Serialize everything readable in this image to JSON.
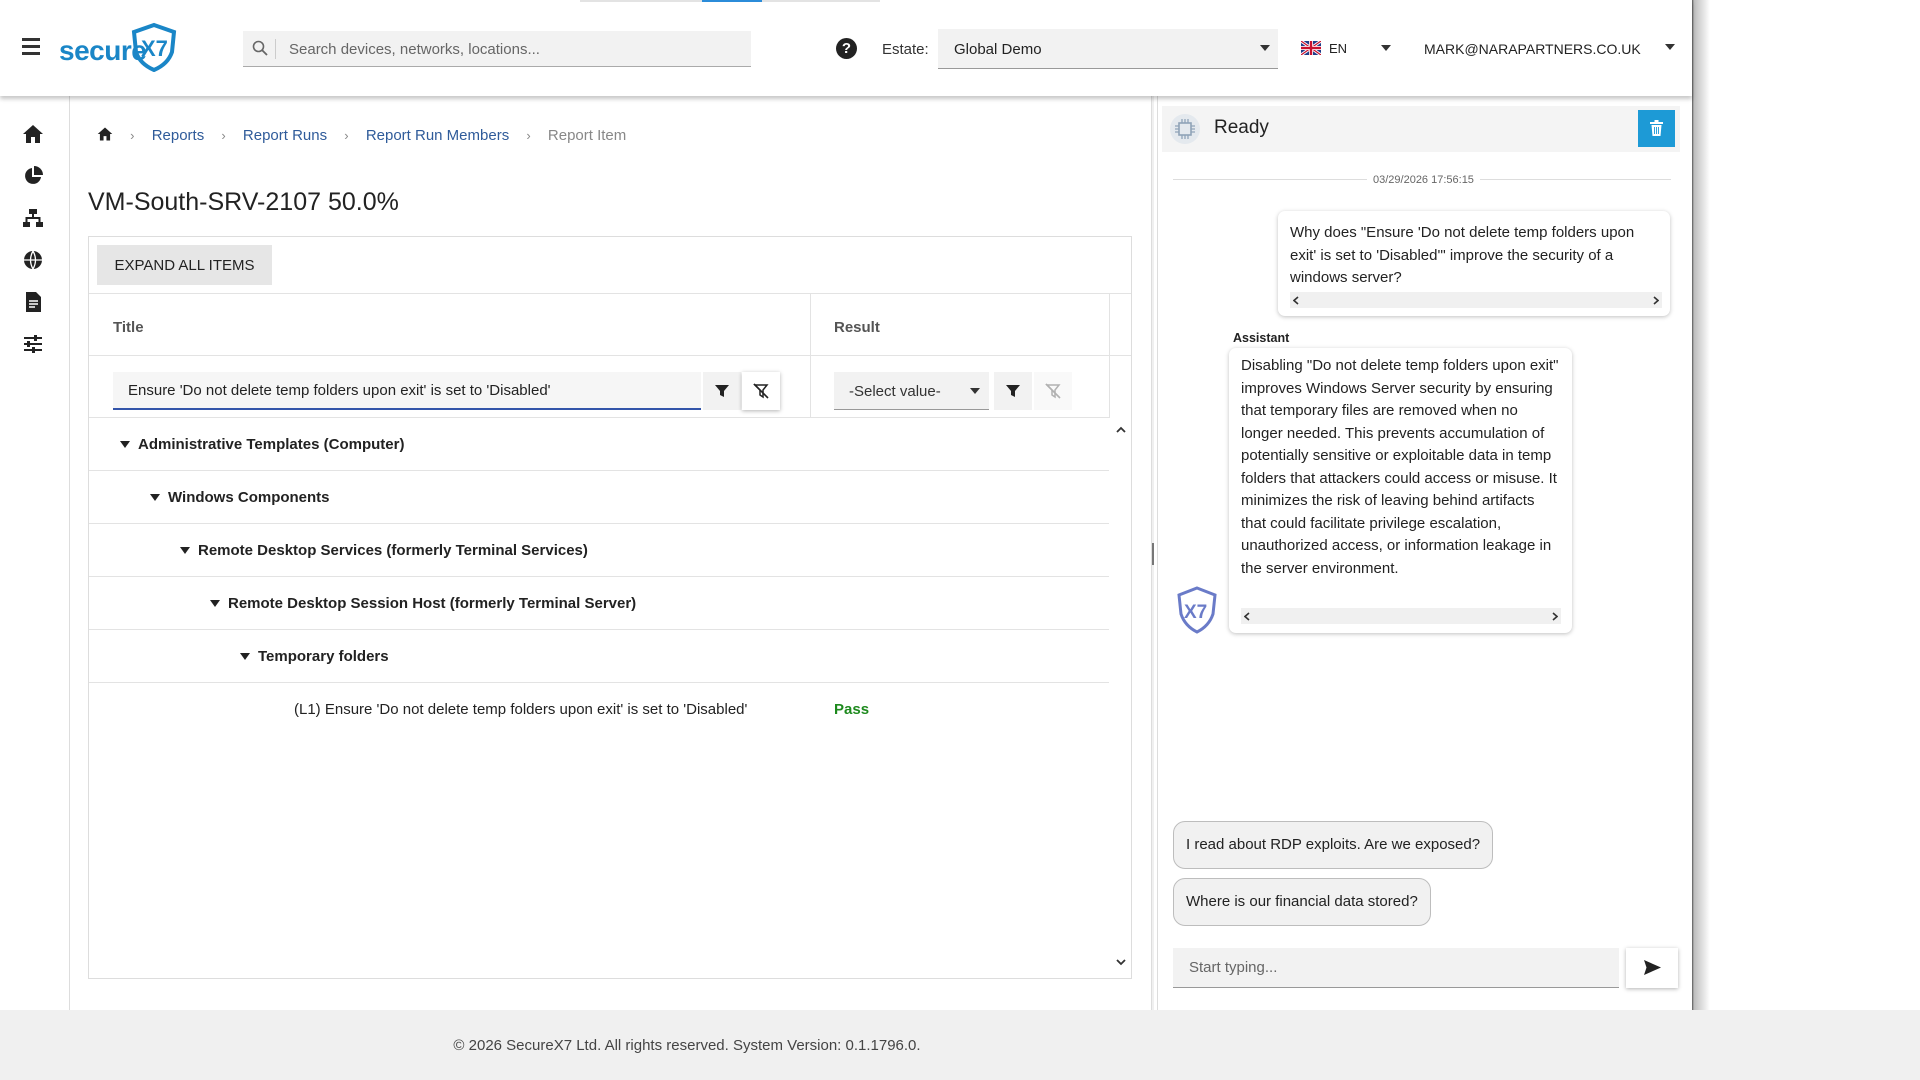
{
  "header": {
    "logo_text": "secure",
    "search_placeholder": "Search devices, networks, locations...",
    "estate_label": "Estate:",
    "estate_value": "Global Demo",
    "language": "EN",
    "user": "MARK@NARAPARTNERS.CO.UK"
  },
  "sidebar": {
    "icons": [
      "home-icon",
      "pie-chart-icon",
      "network-icon",
      "globe-icon",
      "document-icon",
      "sliders-icon"
    ]
  },
  "breadcrumb": [
    {
      "label": "Reports"
    },
    {
      "label": "Report Runs"
    },
    {
      "label": "Report Run Members"
    },
    {
      "label": "Report Item"
    }
  ],
  "page": {
    "title": "VM-South-SRV-2107 50.0%",
    "expand_all_label": "EXPAND ALL ITEMS",
    "columns": {
      "title": "Title",
      "result": "Result"
    },
    "title_filter_value": "Ensure 'Do not delete temp folders upon exit' is set to 'Disabled'",
    "result_filter_value": "-Select value-",
    "tree": [
      {
        "label": "Administrative Templates (Computer)",
        "level": 0
      },
      {
        "label": "Windows Components",
        "level": 1
      },
      {
        "label": "Remote Desktop Services (formerly Terminal Services)",
        "level": 2
      },
      {
        "label": "Remote Desktop Session Host (formerly Terminal Server)",
        "level": 3
      },
      {
        "label": "Temporary folders",
        "level": 4
      }
    ],
    "leaf": {
      "label": "(L1) Ensure 'Do not delete temp folders upon exit' is set to 'Disabled'",
      "result": "Pass",
      "result_color": "#1e8a1e"
    }
  },
  "assistant": {
    "status": "Ready",
    "timestamp": "03/29/2026 17:56:15",
    "user_message": "Why does \"Ensure 'Do not delete temp folders upon exit' is set to 'Disabled'\" improve the security of a windows server?",
    "assistant_role": "Assistant",
    "assistant_message": "Disabling \"Do not delete temp folders upon exit\" improves Windows Server security by ensuring that temporary files are removed when no longer needed. This prevents accumulation of potentially sensitive or exploitable data in temp folders that attackers could access or misuse. It minimizes the risk of leaving behind artifacts that could facilitate privilege escalation, unauthorized access, or information leakage in the server environment.",
    "suggestions": [
      "I read about RDP exploits. Are we exposed?",
      "Where is our financial data stored?"
    ],
    "input_placeholder": "Start typing...",
    "accent_color": "#1d9ad6"
  },
  "footer": {
    "text": "© 2026 SecureX7 Ltd. All rights reserved.  System Version: 0.1.1796.0."
  }
}
